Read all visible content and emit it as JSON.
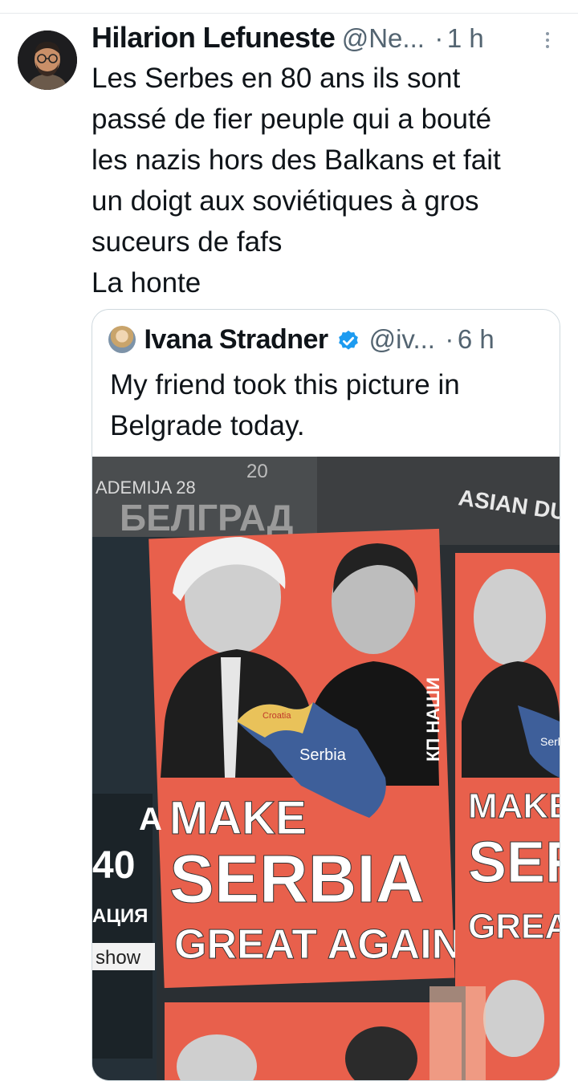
{
  "post": {
    "author_name": "Hilarion Lefuneste",
    "author_handle": "@Ne...",
    "separator": "·",
    "time": "1 h",
    "text": "Les Serbes en 80 ans ils sont\npassé de fier peuple qui a bouté\nles nazis hors des Balkans et fait\nun doigt aux soviétiques à gros\nsuceurs de fafs\nLa honte"
  },
  "quoted_post": {
    "author_name": "Ivana Stradner",
    "author_handle": "@iv...",
    "separator": "·",
    "time": "6 h",
    "text": "My friend took this picture in\nBelgrade today.",
    "verified": true
  },
  "image": {
    "top_left_text": "ADEMIJA 28",
    "top_number": "20",
    "cyrillic_banner": "БЕЛГРАД",
    "right_banner": "ASIAN DU",
    "map_label_serbia": "Serbia",
    "map_label_croatia": "Croatia",
    "side_text": "КП НАШИ",
    "slogan_line1": "MAKE",
    "slogan_line2": "SERBIA",
    "slogan_line3": "GREAT AGAIN",
    "right_slogan_line1": "MAKE",
    "right_slogan_line2": "SER",
    "right_slogan_line3": "GREAT A",
    "left_edge_a": "A",
    "left_edge_digits": "40",
    "left_edge_cyr": "АЦИЯ",
    "left_edge_show": "show",
    "right_serbia": "Serbi",
    "colors": {
      "poster_red": "#e8604c",
      "serbia_blue": "#3e5f9a",
      "croatia_yellow": "#e9c25a"
    }
  }
}
